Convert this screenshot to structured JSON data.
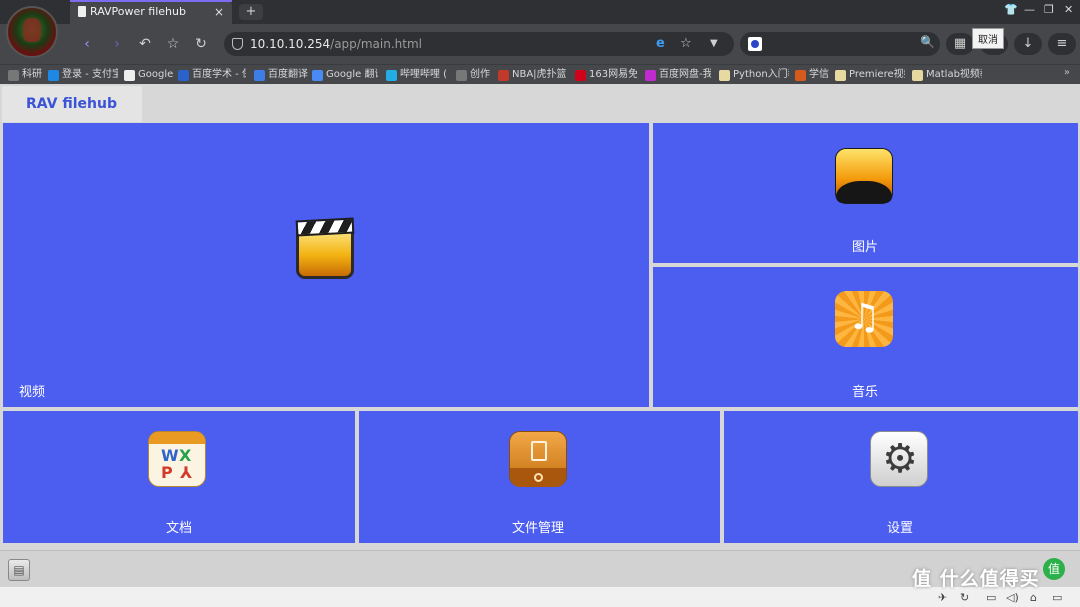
{
  "browser": {
    "tab_title": "RAVPower filehub",
    "tab_close": "×",
    "new_tab": "+",
    "window_controls": [
      "👕",
      "—",
      "❐",
      "✕"
    ],
    "nav": {
      "back": "‹",
      "forward": "›",
      "undo": "↶",
      "favorite": "☆",
      "reload": "↻"
    },
    "address": {
      "host": "10.10.10.254",
      "path": "/app/main.html"
    },
    "address_icons": {
      "ie": "e",
      "star": "☆",
      "dropdown": "▼"
    },
    "search_icon": "🔍",
    "toolbar_icons": {
      "grid": "▦",
      "download": "↓",
      "menu": "≡"
    },
    "tooltip": "取消",
    "bookmarks": [
      {
        "label": "科研",
        "color": "#777777"
      },
      {
        "label": "登录 - 支付宝",
        "color": "#1e88e5"
      },
      {
        "label": "Google",
        "color": "#eeeeee"
      },
      {
        "label": "百度学术 - 保",
        "color": "#2a62c9"
      },
      {
        "label": "百度翻译",
        "color": "#3d7ee6"
      },
      {
        "label": "Google 翻译",
        "color": "#4a8af4"
      },
      {
        "label": "哔哩哔哩 (",
        "color": "#23ade5"
      },
      {
        "label": "创作",
        "color": "#777777"
      },
      {
        "label": "NBA|虎扑篮球",
        "color": "#c0392b"
      },
      {
        "label": "163网易免费",
        "color": "#d0021b"
      },
      {
        "label": "百度网盘-我",
        "color": "#c02bd0"
      },
      {
        "label": "Python入门教",
        "color": "#e8d9a0"
      },
      {
        "label": "学信",
        "color": "#d65a1c"
      },
      {
        "label": "Premiere视频",
        "color": "#e8d9a0"
      },
      {
        "label": "Matlab视频教",
        "color": "#e8d9a0"
      }
    ],
    "bookmarks_more": "»"
  },
  "app": {
    "tab_label": "RAV filehub",
    "tiles": {
      "video": "视频",
      "photos": "图片",
      "music": "音乐",
      "docs": "文档",
      "file_manager": "文件管理",
      "settings": "设置"
    },
    "colors": {
      "tile": "#4c5ef0",
      "accent": "#3b53d6"
    }
  },
  "footer": {
    "floppy": "▤",
    "watermark": "值 什么值得买",
    "watermark_logo": "值",
    "status_icons": [
      "✈",
      "↻",
      "▭",
      "◁)",
      "⌂",
      "▭"
    ]
  }
}
